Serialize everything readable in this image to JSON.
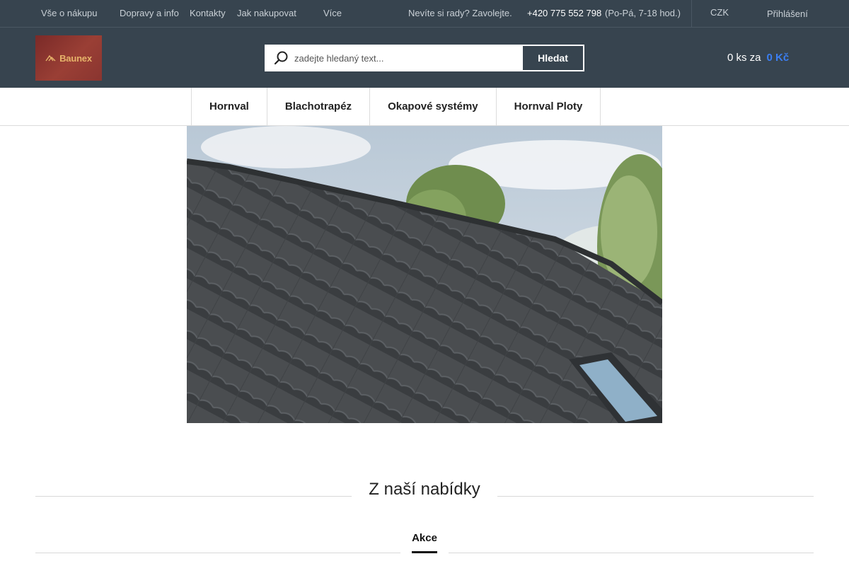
{
  "topbar": {
    "links": [
      "Vše o nákupu",
      "Dopravy a info",
      "Kontakty",
      "Jak nakupovat",
      "Více"
    ],
    "help_text": "Nevíte si rady? Zavolejte.",
    "phone": "+420 775 552 798",
    "hours": "(Po-Pá, 7-18 hod.)",
    "currency": "CZK",
    "login": "Přihlášení"
  },
  "header": {
    "logo_text": "Baunex",
    "search": {
      "placeholder": "zadejte hledaný text...",
      "button_label": "Hledat"
    },
    "cart": {
      "count_text": "0 ks za",
      "price": "0 Kč"
    }
  },
  "nav": {
    "items": [
      "Hornval",
      "Blachotrapéz",
      "Okapové systémy",
      "Hornval Ploty"
    ]
  },
  "main": {
    "section_title": "Z naší nabídky",
    "tabs": [
      "Akce"
    ]
  },
  "colors": {
    "header_bg": "#37444f",
    "accent": "#3b7ff3",
    "logo_bg": "#8a3530"
  }
}
